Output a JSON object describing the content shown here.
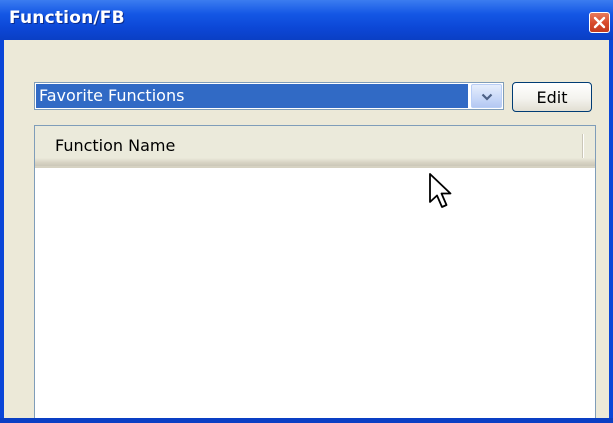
{
  "window": {
    "title": "Function/FB"
  },
  "toolbar": {
    "category_select": {
      "selected": "Favorite Functions"
    },
    "edit_label": "Edit"
  },
  "list": {
    "columns": [
      "Function Name"
    ],
    "rows": []
  },
  "icons": {
    "close": "close-icon",
    "dropdown": "chevron-down-icon",
    "cursor": "mouse-pointer-icon"
  },
  "colors": {
    "titlebar": "#0c47d6",
    "selection": "#316ac5",
    "close_button": "#d6492b",
    "dialog_background": "#ece9d8"
  }
}
